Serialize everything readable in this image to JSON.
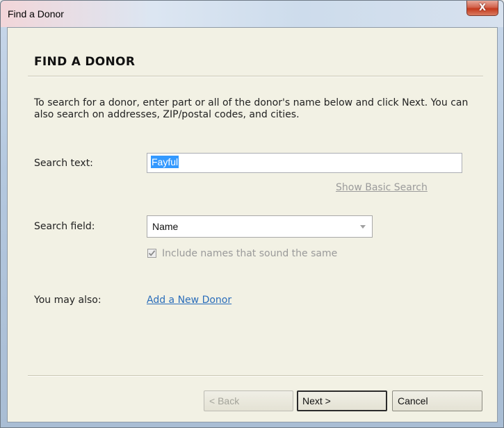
{
  "window": {
    "title": "Find a Donor",
    "close_glyph": "X"
  },
  "page": {
    "heading": "FIND A DONOR",
    "instructions": "To search for a donor, enter part or all of the donor's name below and click Next. You can also search on addresses, ZIP/postal codes, and cities."
  },
  "search": {
    "label": "Search text:",
    "value": "Fayful",
    "basic_search_link": "Show Basic Search"
  },
  "field": {
    "label": "Search field:",
    "selected": "Name",
    "soundex_checked": true,
    "soundex_label": "Include names that sound the same"
  },
  "also": {
    "label": "You may also:",
    "add_link": "Add a New Donor"
  },
  "buttons": {
    "back": "< Back",
    "next": "Next >",
    "cancel": "Cancel"
  },
  "colors": {
    "dialog_background": "#f2f1e4",
    "link_blue": "#2a6dba",
    "selection_blue": "#3399ff",
    "close_red": "#c4391d"
  }
}
